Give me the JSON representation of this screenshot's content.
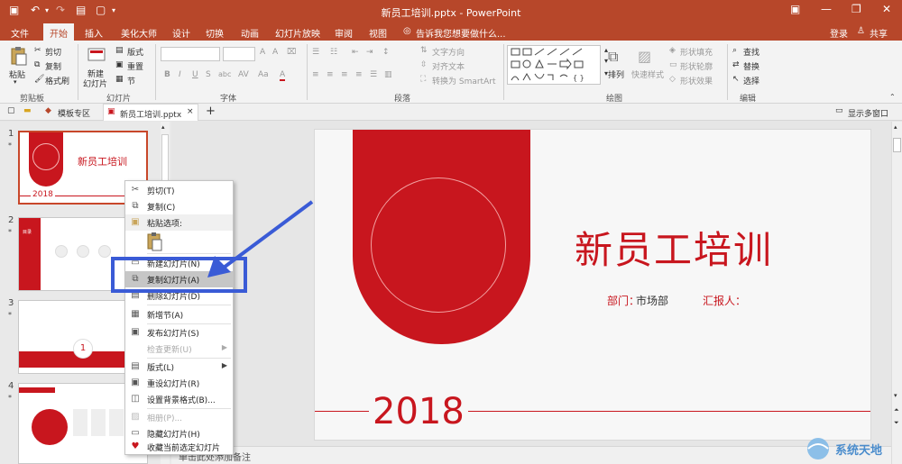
{
  "window": {
    "title": "新员工培训.pptx - PowerPoint",
    "login": "登录",
    "share": "共享"
  },
  "ribbon_tabs": [
    "文件",
    "开始",
    "插入",
    "美化大师",
    "设计",
    "切换",
    "动画",
    "幻灯片放映",
    "审阅",
    "视图"
  ],
  "active_tab": "开始",
  "tell_me": "告诉我您想要做什么...",
  "ribbon": {
    "clipboard": {
      "paste": "粘贴",
      "cut": "剪切",
      "copy": "复制",
      "format_painter": "格式刷",
      "group": "剪贴板"
    },
    "slides": {
      "new_slide_1": "新建",
      "new_slide_2": "幻灯片",
      "layout": "版式",
      "reset": "重置",
      "section": "节",
      "group": "幻灯片"
    },
    "font": {
      "group": "字体",
      "buttons": [
        "B",
        "I",
        "U",
        "S",
        "abc",
        "AV",
        "Aa",
        "A"
      ]
    },
    "paragraph": {
      "text_direction": "文字方向",
      "align_text": "对齐文本",
      "smartart": "转换为 SmartArt",
      "group": "段落"
    },
    "drawing": {
      "arrange": "排列",
      "quick_styles": "快速样式",
      "shape_fill": "形状填充",
      "shape_outline": "形状轮廓",
      "shape_effects": "形状效果",
      "group": "绘图"
    },
    "editing": {
      "find": "查找",
      "replace": "替换",
      "select": "选择",
      "group": "编辑"
    }
  },
  "doc_tabs": [
    {
      "label": "模板专区"
    },
    {
      "label": "新员工培训.pptx"
    }
  ],
  "doc_tab_close": "×",
  "doc_tab_add": "+",
  "multi_window": "显示多窗口",
  "thumbnails": [
    {
      "num": "1",
      "title": "新员工培训",
      "year": "2018"
    },
    {
      "num": "2",
      "label": "目录"
    },
    {
      "num": "3",
      "num_badge": "1"
    },
    {
      "num": "4"
    }
  ],
  "context_menu": [
    {
      "label": "剪切(T)",
      "icon": "scissors-icon",
      "enabled": true
    },
    {
      "label": "复制(C)",
      "icon": "copy-icon",
      "enabled": true
    },
    {
      "label": "粘贴选项:",
      "icon": "paste-icon",
      "enabled": true
    },
    {
      "label": "新建幻灯片(N)",
      "icon": "new-slide-icon",
      "enabled": true
    },
    {
      "label": "复制幻灯片(A)",
      "icon": "duplicate-slide-icon",
      "enabled": true,
      "highlighted": true
    },
    {
      "label": "删除幻灯片(D)",
      "icon": "delete-slide-icon",
      "enabled": true
    },
    {
      "label": "新增节(A)",
      "icon": "section-icon",
      "enabled": true
    },
    {
      "label": "发布幻灯片(S)",
      "icon": "publish-icon",
      "enabled": true
    },
    {
      "label": "检查更新(U)",
      "icon": "",
      "enabled": false,
      "submenu": true
    },
    {
      "label": "版式(L)",
      "icon": "layout-icon",
      "enabled": true,
      "submenu": true
    },
    {
      "label": "重设幻灯片(R)",
      "icon": "reset-icon",
      "enabled": true
    },
    {
      "label": "设置背景格式(B)...",
      "icon": "background-icon",
      "enabled": true
    },
    {
      "label": "相册(P)...",
      "icon": "album-icon",
      "enabled": false
    },
    {
      "label": "隐藏幻灯片(H)",
      "icon": "hide-icon",
      "enabled": true
    },
    {
      "label": "收藏当前选定幻灯片",
      "icon": "heart-icon",
      "enabled": true
    }
  ],
  "slide": {
    "title": "新员工培训",
    "dept_label": "部门：",
    "dept_value": "市场部",
    "reporter_label": "汇报人：",
    "year": "2018"
  },
  "notes_placeholder": "单击此处添加备注",
  "watermark": "系统天地",
  "colors": {
    "brand": "#b7472a",
    "slide_red": "#c8161e",
    "highlight_blue": "#3a5bd6"
  }
}
